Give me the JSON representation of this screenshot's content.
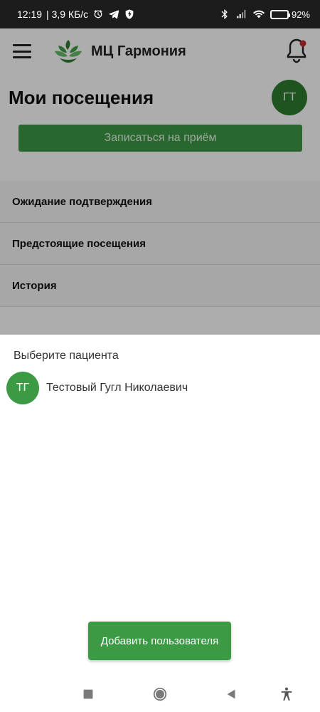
{
  "status_bar": {
    "time": "12:19",
    "network_speed": "| 3,9 КБ/с",
    "battery_percent": "92%",
    "battery_level": 0.92,
    "icons": [
      "alarm-icon",
      "telegram-icon",
      "vpn-shield-icon",
      "bluetooth-icon",
      "signal-icon",
      "wifi-icon",
      "battery-icon"
    ]
  },
  "header": {
    "app_name": "МЦ Гармония",
    "icons": [
      "menu-icon",
      "lotus-logo-icon",
      "bell-icon"
    ]
  },
  "main": {
    "page_title": "Мои посещения",
    "user_initials": "ГТ",
    "book_button_label": "Записаться на приём",
    "sections": [
      "Ожидание подтверждения",
      "Предстоящие посещения",
      "История"
    ]
  },
  "sheet": {
    "title": "Выберите пациента",
    "patient": {
      "initials": "ТГ",
      "name": "Тестовый Гугл Николаевич"
    },
    "add_user_label": "Добавить пользователя"
  },
  "colors": {
    "accent": "#3c9a44",
    "avatar_dark": "#2e7d32",
    "status_bar": "#1c1c1c",
    "notification_dot": "#c62828"
  }
}
